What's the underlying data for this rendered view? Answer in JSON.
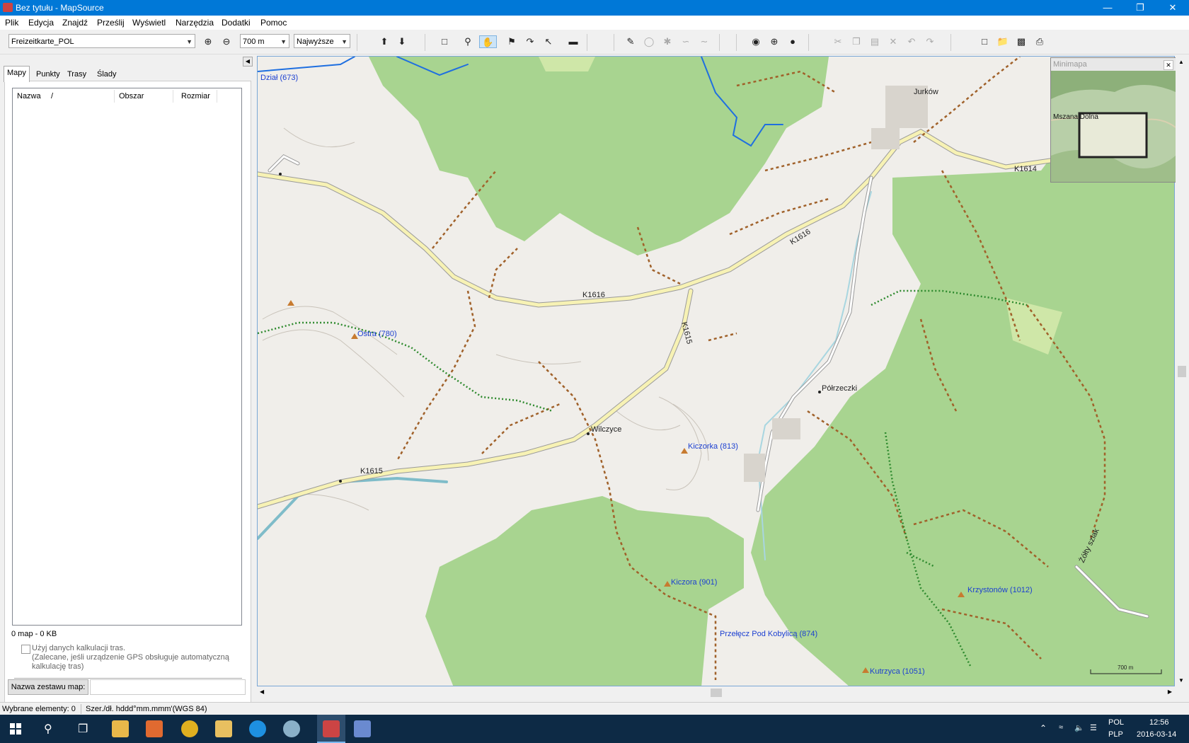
{
  "window": {
    "title": "Bez tytułu - MapSource"
  },
  "menu": [
    "Plik",
    "Edycja",
    "Znajdź",
    "Prześlij",
    "Wyświetl",
    "Narzędzia",
    "Dodatki",
    "Pomoc"
  ],
  "toolbar": {
    "map_product": "Freizeitkarte_POL",
    "zoom": "700 m",
    "detail": "Najwyższe"
  },
  "left_panel": {
    "tabs": [
      "Mapy",
      "Punkty",
      "Trasy",
      "Ślady"
    ],
    "selected_tab": "Mapy",
    "columns": [
      "Nazwa",
      "/",
      "Obszar",
      "Rozmiar"
    ],
    "summary": "0 map - 0 KB",
    "checkbox_label": "Użyj danych kalkulacji tras.",
    "checkbox_note_1": "(Zalecane, jeśli urządzenie GPS obsługuje automatyczną",
    "checkbox_note_2": "kalkulację tras)",
    "mapset_button": "Nazwa zestawu map:",
    "mapset_value": ""
  },
  "minimap": {
    "title": "Minimapa",
    "label": "Mszana Dolna"
  },
  "map": {
    "labels": {
      "dzial": "Dział (673)",
      "jurkow": "Jurków",
      "k1614": "K1614",
      "k1616a": "K1616",
      "k1616b": "K1616",
      "k1615a": "K1615",
      "k1615b": "K1615",
      "ostra": "Ostra (780)",
      "polrzeczki": "Półrzeczki",
      "wilczyce": "Wilczyce",
      "kiczorka": "Kiczorka (813)",
      "kiczora": "Kiczora (901)",
      "przelecz": "Przełęcz Pod Kobylicą (874)",
      "krzystonow": "Krzystonów (1012)",
      "kutrzyca": "Kutrzyca (1051)",
      "zolty": "Żółty szlak",
      "scale": "700 m"
    }
  },
  "status": {
    "selected": "Wybrane elementy: 0",
    "coords": "Szer./dł. hddd°mm.mmm'(WGS 84)"
  },
  "taskbar": {
    "lang1": "POL",
    "lang2": "PLP",
    "time": "12:56",
    "date": "2016-03-14"
  },
  "colors": {
    "accent": "#0078d7",
    "forest": "#a8d490",
    "road": "#f7f2b4",
    "trail_brown": "#a0612a",
    "trail_green": "#2e8a2e",
    "water": "#1f6fe0",
    "label_blue": "#1b3fd1"
  }
}
